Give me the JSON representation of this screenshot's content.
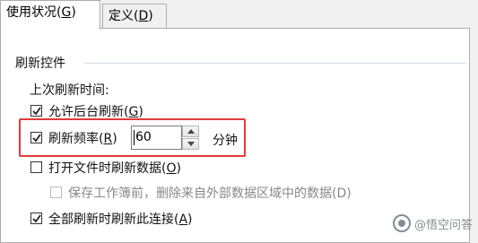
{
  "tabs": [
    {
      "label": "使用状况(",
      "key": "G",
      "suffix": ")"
    },
    {
      "label": "定义(",
      "key": "D",
      "suffix": ")"
    }
  ],
  "group": {
    "title": "刷新控件"
  },
  "last_refresh": {
    "label": "上次刷新时间:"
  },
  "options": {
    "background_refresh": {
      "label": "允许后台刷新(",
      "key": "G",
      "suffix": ")",
      "checked": true
    },
    "refresh_every": {
      "label": "刷新频率(",
      "key": "R",
      "suffix": ")",
      "checked": true,
      "value": "60",
      "unit": "分钟"
    },
    "refresh_on_open": {
      "label": "打开文件时刷新数据(",
      "key": "O",
      "suffix": ")",
      "checked": false
    },
    "remove_external": {
      "label": "保存工作簿前，删除来自外部数据区域中的数据(D)",
      "checked": false,
      "disabled": true
    },
    "refresh_all": {
      "label": "全部刷新时刷新此连接(",
      "key": "A",
      "suffix": ")",
      "checked": true
    }
  },
  "highlight_color": "#e23b3b",
  "watermark": {
    "text": "@悟空问答"
  }
}
